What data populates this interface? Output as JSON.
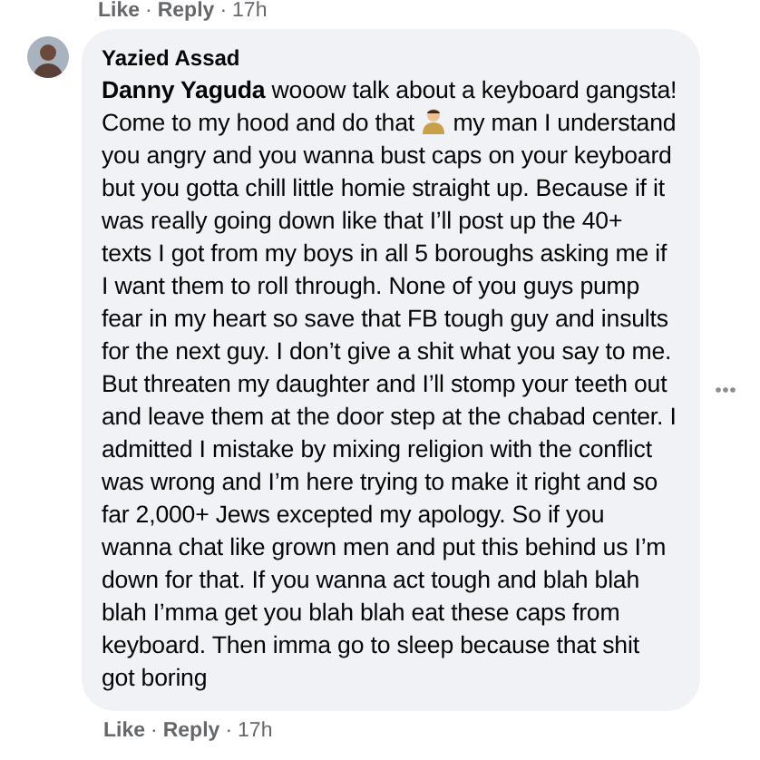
{
  "previous_comment": {
    "actions": [
      "Like",
      "Reply"
    ],
    "separator": "·",
    "time": "17h"
  },
  "comment": {
    "author": "Yazied Assad",
    "mention": "Danny Yaguda",
    "text_before": "wooow talk about a keyboard gangsta! Come to my hood and do that",
    "text_after": "my man I understand you angry and you wanna bust caps on your keyboard but you gotta chill little homie straight up. Because if it was really going down like that I’ll post up the 40+ texts I got from my boys in all 5 boroughs asking me if I want them to roll through. None of you guys pump fear in my heart so save that FB tough guy and insults for the next guy. I don’t give a shit what you say to me. But threaten my daughter and I’ll stomp your teeth out and leave them at the door step at the chabad center. I admitted I mistake by mixing religion with the conflict was wrong and I’m here trying to make it right and so far 2,000+ Jews excepted my apology. So if you wanna chat like grown men and put this behind us I’m down for that. If you wanna act tough and blah blah blah I’mma get you blah blah eat these caps from keyboard. Then imma go to sleep because that shit got boring",
    "actions": [
      "Like",
      "Reply"
    ],
    "separator": "·",
    "time": "17h"
  }
}
